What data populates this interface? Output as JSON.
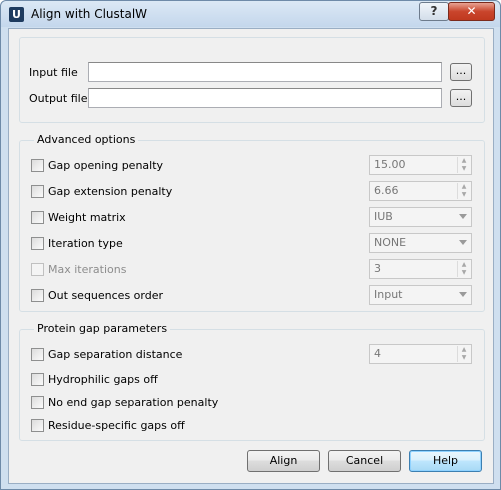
{
  "window": {
    "title": "Align with ClustalW",
    "app_icon_letter": "U",
    "help_glyph": "?",
    "close_glyph": "✕"
  },
  "files": {
    "input_label": "Input file",
    "input_value": "",
    "output_label": "Output file",
    "output_value": "",
    "browse_label": "..."
  },
  "advanced": {
    "title": "Advanced options",
    "gap_opening": {
      "label": "Gap opening penalty",
      "checked": false,
      "value": "15.00"
    },
    "gap_extension": {
      "label": "Gap extension penalty",
      "checked": false,
      "value": "6.66"
    },
    "weight_matrix": {
      "label": "Weight matrix",
      "checked": false,
      "value": "IUB"
    },
    "iteration_type": {
      "label": "Iteration type",
      "checked": false,
      "value": "NONE"
    },
    "max_iterations": {
      "label": "Max iterations",
      "checked": false,
      "value": "3",
      "enabled": false
    },
    "out_order": {
      "label": "Out sequences order",
      "checked": false,
      "value": "Input"
    }
  },
  "protein": {
    "title": "Protein gap parameters",
    "gap_separation": {
      "label": "Gap separation distance",
      "checked": false,
      "value": "4"
    },
    "hydrophilic": {
      "label": "Hydrophilic gaps off",
      "checked": false
    },
    "no_end_gap": {
      "label": "No end gap separation penalty",
      "checked": false
    },
    "residue_specific": {
      "label": "Residue-specific gaps off",
      "checked": false
    }
  },
  "buttons": {
    "align": "Align",
    "cancel": "Cancel",
    "help": "Help"
  },
  "icons": {
    "spin_up": "▲",
    "spin_down": "▼"
  }
}
